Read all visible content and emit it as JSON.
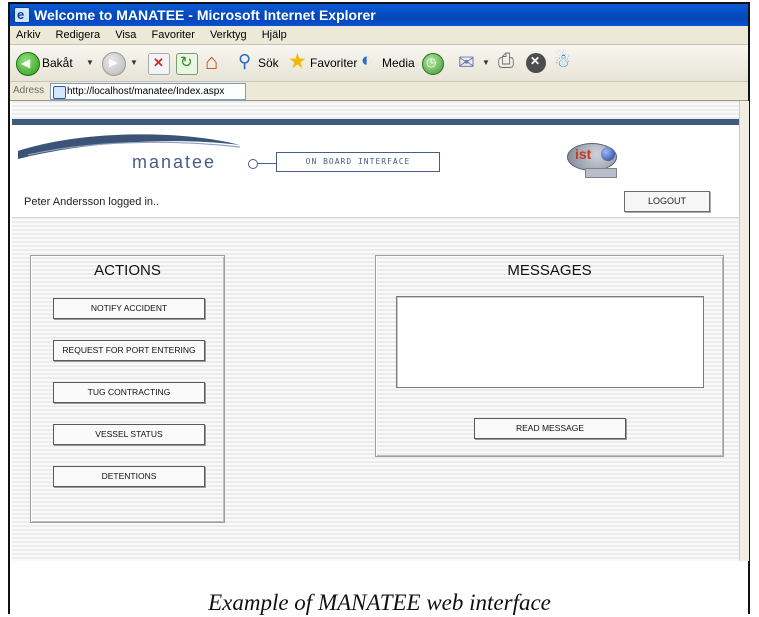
{
  "window": {
    "title": "Welcome to MANATEE - Microsoft Internet Explorer"
  },
  "menu": [
    "Arkiv",
    "Redigera",
    "Visa",
    "Favoriter",
    "Verktyg",
    "Hjälp"
  ],
  "toolbar": {
    "back_label": "Bakåt",
    "search_label": "Sök",
    "favorites_label": "Favoriter",
    "media_label": "Media",
    "icons": [
      "back-icon",
      "forward-icon",
      "stop-icon",
      "refresh-icon",
      "home-icon",
      "search-icon",
      "favorites-star-icon",
      "media-icon",
      "history-icon",
      "mail-icon",
      "print-icon",
      "close-icon",
      "messenger-icon"
    ]
  },
  "address": {
    "label": "Adress",
    "url": "http://localhost/manatee/Index.aspx"
  },
  "header": {
    "logo_text": "manatee",
    "tagline": "ON BOARD INTERFACE",
    "partner_logo_text": "ist"
  },
  "user": {
    "status_text": "Peter Andersson logged in..",
    "logout_label": "LOGOUT"
  },
  "actions": {
    "title": "ACTIONS",
    "buttons": [
      "NOTIFY ACCIDENT",
      "REQUEST FOR PORT ENTERING",
      "TUG CONTRACTING",
      "VESSEL STATUS",
      "DETENTIONS"
    ]
  },
  "messages": {
    "title": "MESSAGES",
    "read_label": "READ MESSAGE",
    "content": ""
  },
  "caption": "Example of MANATEE web interface",
  "colors": {
    "titlebar": "#0447b8",
    "header_band": "#3f5a7b",
    "logo": "#4a5d84"
  }
}
